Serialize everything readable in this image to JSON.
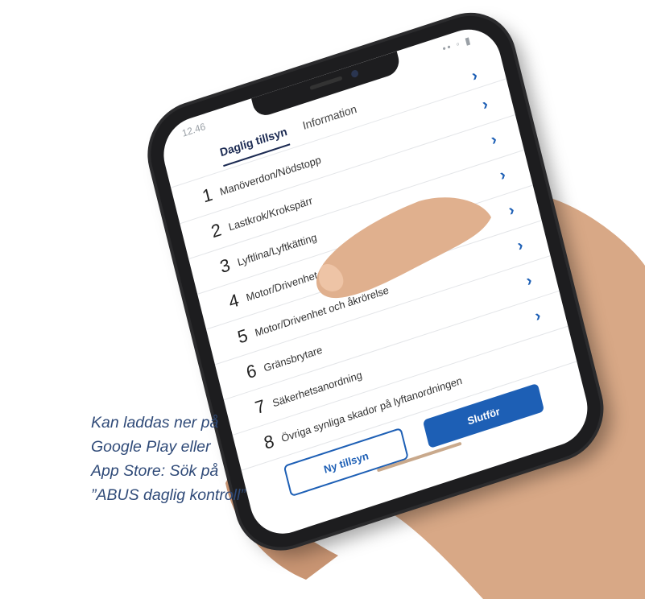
{
  "status_bar": {
    "time": "12.46",
    "icons": "•• ◦ ▮"
  },
  "tabs": [
    {
      "label": "Daglig tillsyn",
      "active": true
    },
    {
      "label": "Information",
      "active": false
    }
  ],
  "checklist": [
    {
      "num": "1",
      "label": "Manöverdon/Nödstopp"
    },
    {
      "num": "2",
      "label": "Lastkrok/Krokspärr"
    },
    {
      "num": "3",
      "label": "Lyftlina/Lyftkätting"
    },
    {
      "num": "4",
      "label": "Motor/Drivenhet och broms lyft/ sänk"
    },
    {
      "num": "5",
      "label": "Motor/Drivenhet och åkrörelse"
    },
    {
      "num": "6",
      "label": "Gränsbrytare"
    },
    {
      "num": "7",
      "label": "Säkerhetsanordning"
    },
    {
      "num": "8",
      "label": "Övriga synliga skador på lyftanordningen"
    }
  ],
  "buttons": {
    "new": "Ny tillsyn",
    "done": "Slutför"
  },
  "caption": [
    "Kan laddas ner på",
    "Google Play eller",
    "App Store: Sök på",
    "”ABUS daglig kontroll”"
  ],
  "colors": {
    "accent": "#1d5fb5",
    "navy": "#1b2a52",
    "caption": "#2f4a78"
  }
}
